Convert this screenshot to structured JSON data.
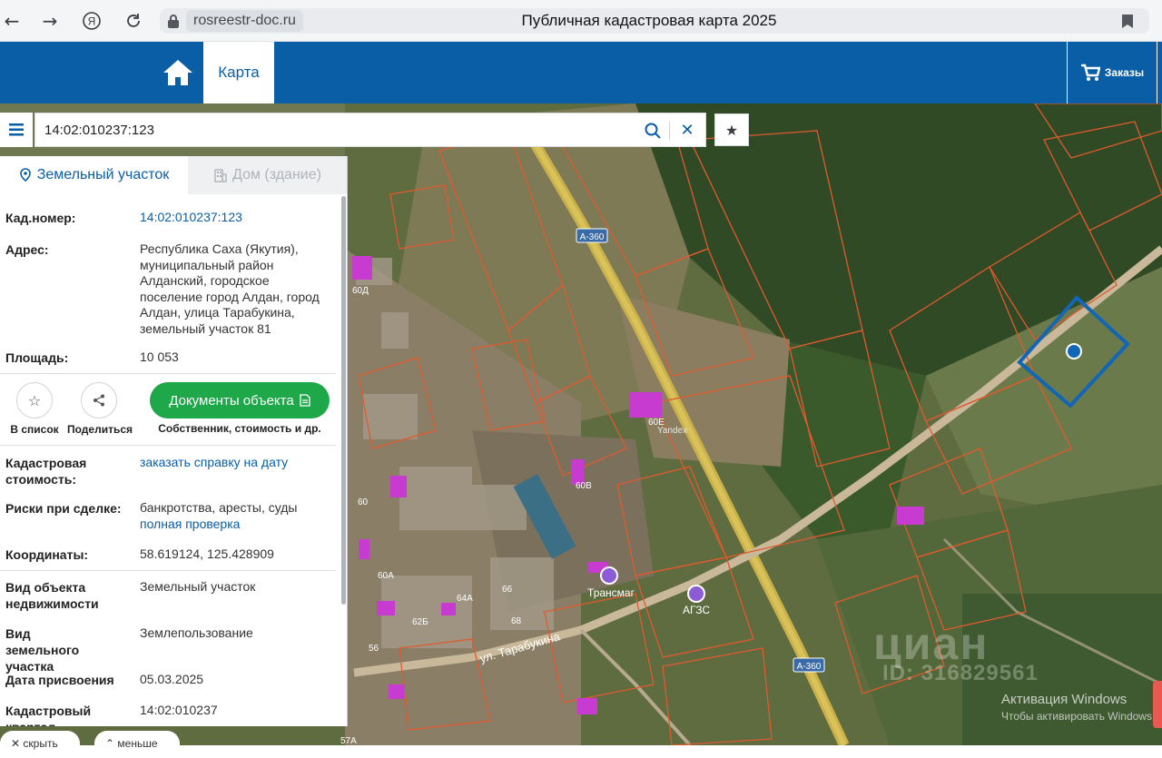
{
  "browser": {
    "url_host": "rosreestr-doc.ru",
    "page_title": "Публичная кадастровая карта 2025",
    "icons": [
      "back-arrow-icon",
      "forward-arrow-icon",
      "yandex-icon",
      "reload-icon",
      "lock-icon",
      "bookmark-icon"
    ]
  },
  "header": {
    "tab_map": "Карта",
    "orders_label": "Заказы",
    "colors": {
      "brand_blue": "#0a5ea6",
      "accent_green": "#1fa84a"
    }
  },
  "search": {
    "value": "14:02:010237:123",
    "placeholder": ""
  },
  "panel": {
    "tab_land": "Земельный участок",
    "tab_house": "Дом (здание)",
    "fields": {
      "cad_number_label": "Кад.номер:",
      "cad_number_value": "14:02:010237:123",
      "address_label": "Адрес:",
      "address_value": "Республика Саха (Якутия), муниципальный район Алданский, городское поселение город Алдан, город Алдан, улица Тарабукина, земельный участок 81",
      "area_label": "Площадь:",
      "area_value": "10 053",
      "cad_cost_label": "Кадастровая стоимость:",
      "cad_cost_value": "заказать справку на дату",
      "risks_label": "Риски при сделке:",
      "risks_value": "банкротства, аресты, суды",
      "risks_link": "полная проверка",
      "coords_label": "Координаты:",
      "coords_value": "58.619124, 125.428909",
      "object_type_label": "Вид объекта недвижимости",
      "object_type_value": "Земельный участок",
      "land_type_label": "Вид земельного участка",
      "land_type_value": "Землепользование",
      "date_label": "Дата присвоения",
      "date_value": "05.03.2025",
      "quarter_label": "Кадастровый квартал",
      "quarter_value": "14:02:010237"
    },
    "actions": {
      "add_to_list": "В список",
      "share": "Поделиться",
      "documents": "Документы объекта",
      "documents_caption": "Собственник, стоимость и др."
    }
  },
  "bottom": {
    "hide": "скрыть",
    "less": "меньше"
  },
  "map": {
    "labels": {
      "road_a360_top": "А-360",
      "road_a360_bottom": "А-360",
      "street": "ул. Тарабукина",
      "poi_transmag": "Трансмаг",
      "poi_agzs": "АГЗС",
      "yandex": "Yandex",
      "lbl_60d": "60Д",
      "lbl_60e": "60Е",
      "lbl_60v": "60В",
      "lbl_60": "60",
      "lbl_60a": "60А",
      "lbl_64a": "64А",
      "lbl_62b": "62Б",
      "lbl_66": "66",
      "lbl_68": "68",
      "lbl_56": "56",
      "lbl_57a": "57А"
    }
  },
  "watermark": {
    "cian": "циан",
    "id": "ID: 316829561",
    "windows_title": "Активация Windows",
    "windows_sub": "Чтобы активировать Windows"
  }
}
